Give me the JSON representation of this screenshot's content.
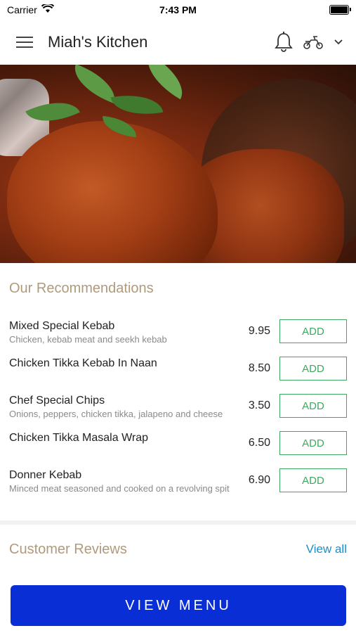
{
  "status_bar": {
    "carrier": "Carrier",
    "time": "7:43 PM"
  },
  "header": {
    "title": "Miah's Kitchen"
  },
  "recommendations": {
    "title": "Our Recommendations",
    "items": [
      {
        "name": "Mixed Special Kebab",
        "description": "Chicken, kebab meat and seekh kebab",
        "price": "9.95",
        "button": "ADD"
      },
      {
        "name": "Chicken Tikka Kebab In Naan",
        "description": "",
        "price": "8.50",
        "button": "ADD"
      },
      {
        "name": "Chef Special Chips",
        "description": "Onions, peppers, chicken tikka, jalapeno and cheese",
        "price": "3.50",
        "button": "ADD"
      },
      {
        "name": "Chicken Tikka Masala Wrap",
        "description": "",
        "price": "6.50",
        "button": "ADD"
      },
      {
        "name": "Donner Kebab",
        "description": "Minced meat seasoned and cooked on a revolving spit",
        "price": "6.90",
        "button": "ADD"
      }
    ]
  },
  "reviews": {
    "title": "Customer Reviews",
    "view_all": "View all"
  },
  "cta": {
    "label": "VIEW MENU"
  },
  "colors": {
    "accent_green": "#3fa860",
    "primary_blue": "#0a2ed6",
    "link_blue": "#1e8cc8",
    "section_title": "#b09a7c"
  }
}
